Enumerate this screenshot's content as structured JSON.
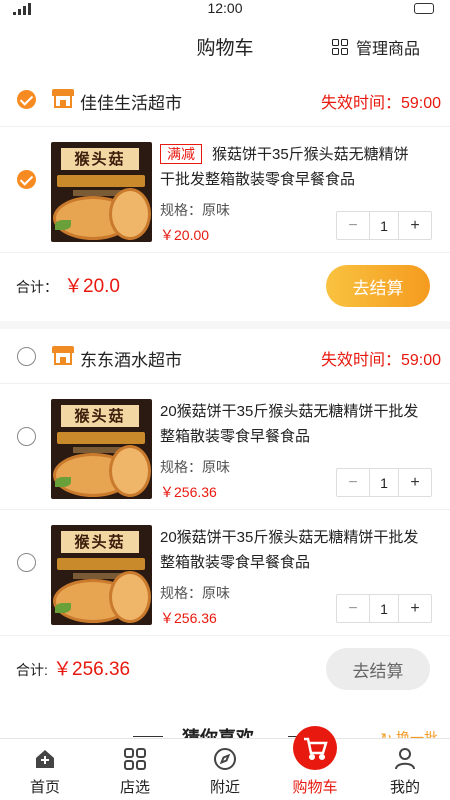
{
  "status_bar": {
    "time": "12:00"
  },
  "header": {
    "title": "购物车",
    "manage_label": "管理商品"
  },
  "stores": [
    {
      "name": "佳佳生活超市",
      "expire": "失效时间：59:00",
      "items": [
        {
          "tag": "满减",
          "name": "猴菇饼干35斤猴头菇无糖精饼干批发整箱散装零食早餐食品",
          "spec": "规格：原味",
          "price": "￥20.00",
          "qty": "1"
        }
      ],
      "total_label": "合计：",
      "total": "￥20.0",
      "checkout": "去结算"
    },
    {
      "name": "东东酒水超市",
      "expire": "失效时间：59:00",
      "items": [
        {
          "name": "20猴菇饼干35斤猴头菇无糖精饼干批发整箱散装零食早餐食品",
          "spec": "规格：原味",
          "price": "￥256.36",
          "qty": "1"
        },
        {
          "name": "20猴菇饼干35斤猴头菇无糖精饼干批发整箱散装零食早餐食品",
          "spec": "规格：原味",
          "price": "￥256.36",
          "qty": "1"
        }
      ],
      "total_label": "合计:",
      "total": "￥256.36",
      "checkout": "去结算"
    }
  ],
  "product_image_text": "猴头菇",
  "guess": {
    "title": "猜你喜欢",
    "refresh": "换一批"
  },
  "tabbar": [
    {
      "label": "首页",
      "icon": "home-icon"
    },
    {
      "label": "店选",
      "icon": "grid-icon"
    },
    {
      "label": "附近",
      "icon": "compass-icon"
    },
    {
      "label": "购物车",
      "icon": "cart-icon"
    },
    {
      "label": "我的",
      "icon": "user-icon"
    }
  ],
  "colors": {
    "accent": "#f78b22",
    "price": "#e8190f",
    "checkout_gradient": [
      "#f9c240",
      "#f59b1f"
    ]
  }
}
